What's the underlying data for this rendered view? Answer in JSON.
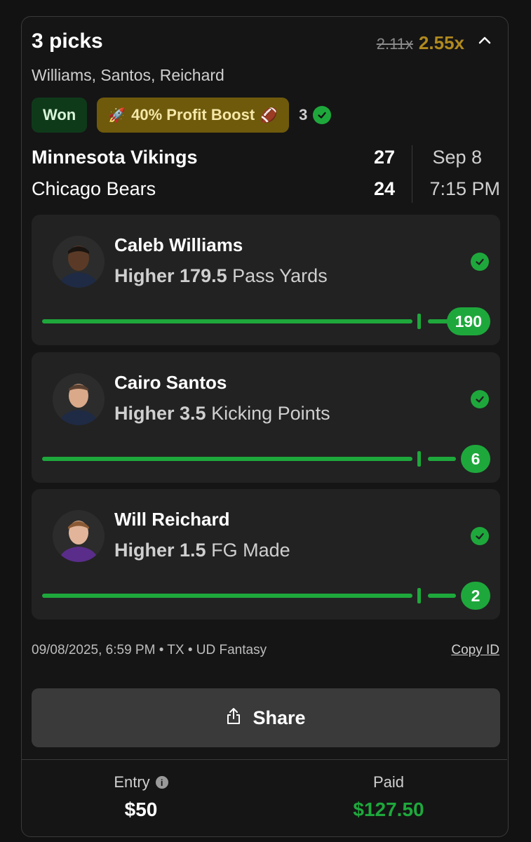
{
  "header": {
    "title": "3 picks",
    "old_multiplier": "2.11x",
    "new_multiplier": "2.55x",
    "players": "Williams, Santos, Reichard"
  },
  "badges": {
    "status": "Won",
    "boost": "40% Profit Boost",
    "hit_count": "3"
  },
  "game": {
    "team1": "Minnesota Vikings",
    "team2": "Chicago Bears",
    "score1": "27",
    "score2": "24",
    "date": "Sep 8",
    "time": "7:15 PM"
  },
  "picks": [
    {
      "name": "Caleb Williams",
      "direction": "Higher",
      "line": "179.5",
      "stat": "Pass Yards",
      "result": "190"
    },
    {
      "name": "Cairo Santos",
      "direction": "Higher",
      "line": "3.5",
      "stat": "Kicking Points",
      "result": "6"
    },
    {
      "name": "Will Reichard",
      "direction": "Higher",
      "line": "1.5",
      "stat": "FG Made",
      "result": "2"
    }
  ],
  "meta": {
    "info": "09/08/2025, 6:59 PM • TX • UD Fantasy",
    "copy_id": "Copy ID"
  },
  "share_label": "Share",
  "footer": {
    "entry_label": "Entry",
    "entry_value": "$50",
    "paid_label": "Paid",
    "paid_value": "$127.50"
  },
  "colors": {
    "accent_green": "#1ea83c",
    "boost_gold": "#b08a1e",
    "background": "#121212"
  }
}
